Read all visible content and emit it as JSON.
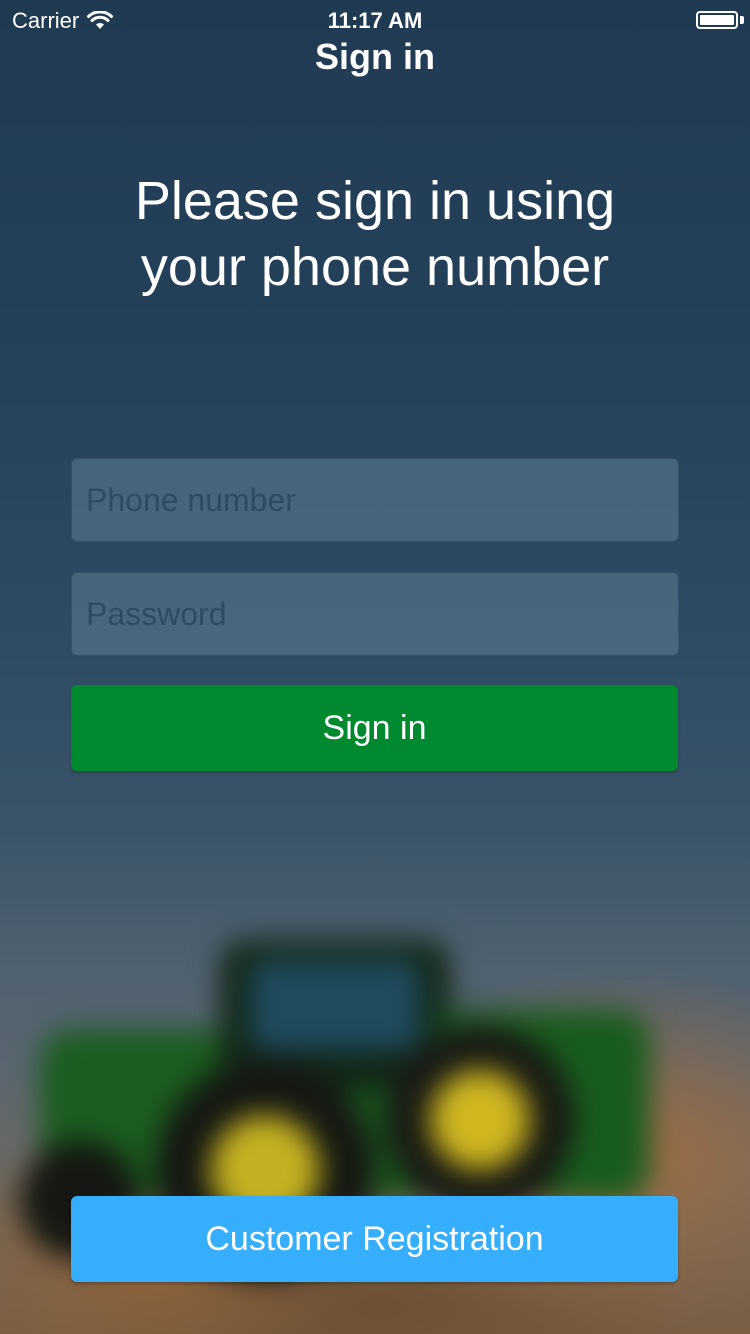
{
  "status_bar": {
    "carrier": "Carrier",
    "time": "11:17 AM",
    "icons": [
      "wifi-icon",
      "battery-icon"
    ]
  },
  "nav": {
    "title": "Sign in"
  },
  "headline": {
    "line1": "Please sign in using",
    "line2": "your phone number"
  },
  "form": {
    "phone_placeholder": "Phone number",
    "phone_value": "",
    "password_placeholder": "Password",
    "password_value": "",
    "signin_label": "Sign in"
  },
  "footer": {
    "register_label": "Customer Registration"
  },
  "colors": {
    "signin_button": "#00892e",
    "register_button": "#37aefc",
    "background": "#2c465c"
  }
}
